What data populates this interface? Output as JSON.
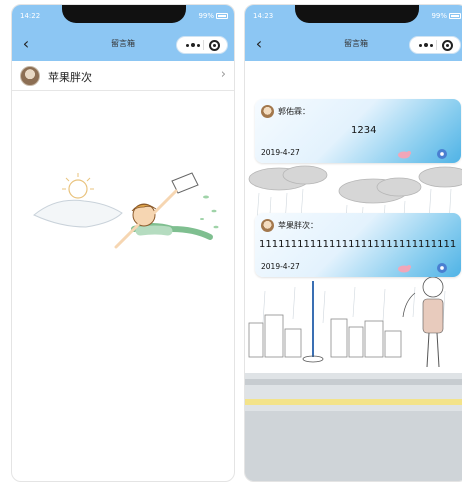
{
  "screens": [
    {
      "status": {
        "time": "14:22",
        "battery": "99%"
      },
      "nav": {
        "back_icon": "back-chevron-icon",
        "title": "留言箱"
      },
      "list": [
        {
          "name": "苹果胖次",
          "avatar_icon": "user-avatar-icon",
          "arrow_icon": "chevron-right-icon"
        }
      ]
    },
    {
      "status": {
        "time": "14:23",
        "battery": "99%"
      },
      "nav": {
        "back_icon": "back-chevron-icon",
        "title": "留言箱"
      },
      "messages": [
        {
          "user": "郭佑霖：",
          "content": "1234",
          "date": "2019-4-27"
        },
        {
          "user": "苹果胖次：",
          "content": "111111111111111111111111111111111111",
          "date": "2019-4-27"
        }
      ]
    }
  ],
  "colors": {
    "nav_bg": "#8cc6f3",
    "card_accent": "#4fb3e6"
  }
}
